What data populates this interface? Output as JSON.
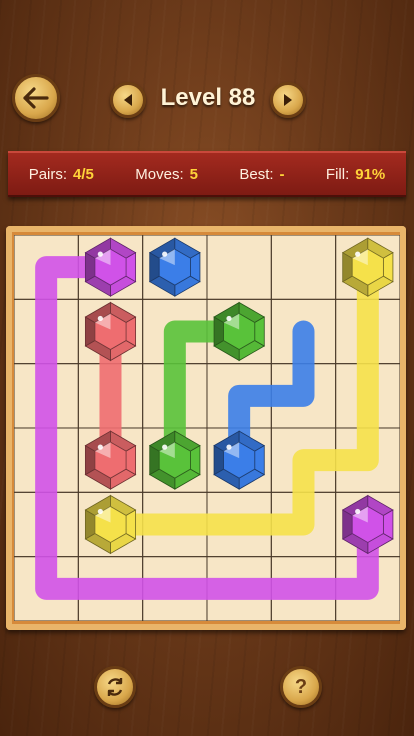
{
  "header": {
    "level_label": "Level 88"
  },
  "stats": {
    "pairs_label": "Pairs:",
    "pairs_value": "4/5",
    "moves_label": "Moves:",
    "moves_value": "5",
    "best_label": "Best:",
    "best_value": "-",
    "fill_label": "Fill:",
    "fill_value": "91%"
  },
  "icons": {
    "back": "arrow-left-icon",
    "prev": "triangle-left-icon",
    "next": "triangle-right-icon",
    "restart": "restart-icon",
    "help": "help-icon"
  },
  "help_symbol": "?",
  "board": {
    "cols": 6,
    "rows": 6,
    "gems": [
      {
        "color": "purple",
        "col": 1,
        "row": 0
      },
      {
        "color": "blue",
        "col": 2,
        "row": 0
      },
      {
        "color": "yellow",
        "col": 5,
        "row": 0
      },
      {
        "color": "red",
        "col": 1,
        "row": 1
      },
      {
        "color": "green",
        "col": 3,
        "row": 1
      },
      {
        "color": "red",
        "col": 1,
        "row": 3
      },
      {
        "color": "green",
        "col": 2,
        "row": 3
      },
      {
        "color": "blue",
        "col": 3,
        "row": 3
      },
      {
        "color": "yellow",
        "col": 1,
        "row": 4
      },
      {
        "color": "purple",
        "col": 5,
        "row": 4
      }
    ],
    "paths": [
      {
        "color": "purple",
        "cells": [
          [
            1,
            0
          ],
          [
            0,
            0
          ],
          [
            0,
            1
          ],
          [
            0,
            2
          ],
          [
            0,
            3
          ],
          [
            0,
            4
          ],
          [
            0,
            5
          ],
          [
            1,
            5
          ],
          [
            2,
            5
          ],
          [
            3,
            5
          ],
          [
            4,
            5
          ],
          [
            5,
            5
          ],
          [
            5,
            4
          ]
        ]
      },
      {
        "color": "red",
        "cells": [
          [
            1,
            1
          ],
          [
            1,
            2
          ],
          [
            1,
            3
          ]
        ]
      },
      {
        "color": "green",
        "cells": [
          [
            3,
            1
          ],
          [
            2,
            1
          ],
          [
            2,
            2
          ],
          [
            2,
            3
          ]
        ]
      },
      {
        "color": "blue",
        "cells": [
          [
            4,
            1
          ],
          [
            4,
            2
          ],
          [
            3,
            2
          ],
          [
            3,
            3
          ]
        ]
      },
      {
        "color": "yellow",
        "cells": [
          [
            5,
            0
          ],
          [
            5,
            1
          ],
          [
            5,
            2
          ],
          [
            5,
            3
          ],
          [
            4,
            3
          ],
          [
            4,
            4
          ],
          [
            3,
            4
          ],
          [
            2,
            4
          ],
          [
            1,
            4
          ]
        ]
      }
    ]
  },
  "colors": {
    "purple": "#d052e8",
    "blue": "#3b7ee8",
    "yellow": "#f5e14a",
    "red": "#ee6d70",
    "green": "#59c23a",
    "grid": "#4a3a2a",
    "cell": "#f7e6c6"
  }
}
